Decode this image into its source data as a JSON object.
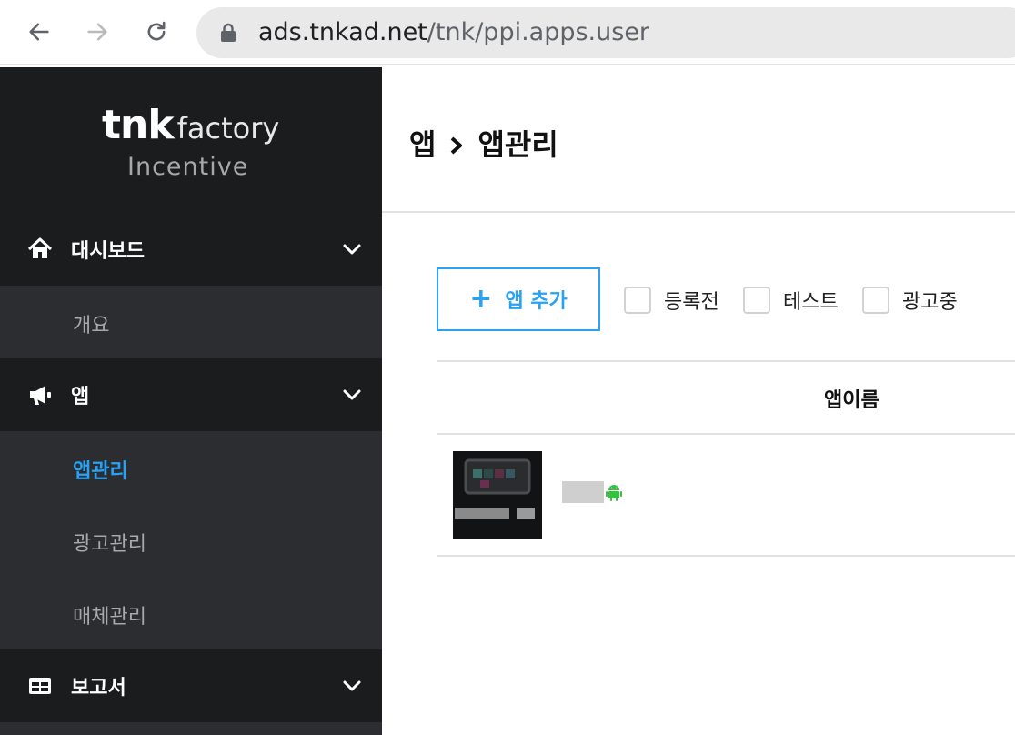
{
  "browser": {
    "url_host": "ads.tnkad.net",
    "url_path": "/tnk/ppi.apps.user"
  },
  "brand": {
    "logo_main": "tnk",
    "logo_suffix": "factory",
    "logo_sub": "Incentive"
  },
  "sidebar": {
    "sections": [
      {
        "label": "대시보드",
        "icon": "home-icon",
        "items": [
          {
            "label": "개요"
          }
        ]
      },
      {
        "label": "앱",
        "icon": "megaphone-icon",
        "items": [
          {
            "label": "앱관리",
            "active": true
          },
          {
            "label": "광고관리"
          },
          {
            "label": "매체관리"
          }
        ]
      },
      {
        "label": "보고서",
        "icon": "table-icon",
        "items": []
      }
    ]
  },
  "breadcrumb": {
    "parent": "앱",
    "current": "앱관리"
  },
  "toolbar": {
    "add_label": "앱 추가"
  },
  "filters": [
    {
      "label": "등록전"
    },
    {
      "label": "테스트"
    },
    {
      "label": "광고중"
    }
  ],
  "table": {
    "columns": [
      "앱이름"
    ],
    "rows": [
      {
        "platform_icon": "android-icon"
      }
    ]
  },
  "colors": {
    "accent": "#2aa2f1",
    "sidebar_bg": "#1b1c1e",
    "submenu_bg": "#2c2d30",
    "android": "#34c23e"
  }
}
